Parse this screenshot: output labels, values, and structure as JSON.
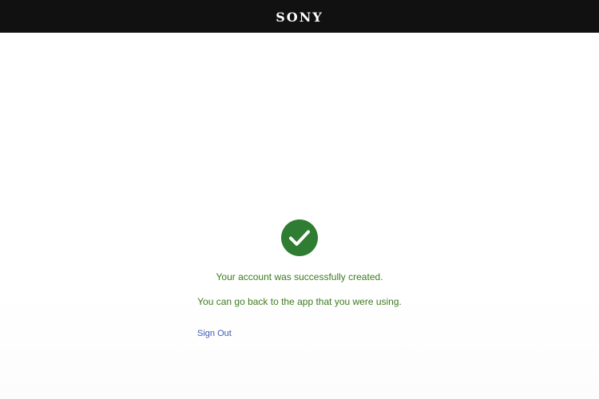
{
  "header": {
    "logo_text": "SONY"
  },
  "status": {
    "icon": "checkmark-circle-icon",
    "success_message": "Your account was successfully created.",
    "instruction_message": "You can go back to the app that you were using."
  },
  "actions": {
    "sign_out_label": "Sign Out"
  },
  "colors": {
    "header_bg": "#111111",
    "success_green": "#2e7d32",
    "message_green": "#3d7a1f",
    "link_blue": "#3b5bb5"
  }
}
